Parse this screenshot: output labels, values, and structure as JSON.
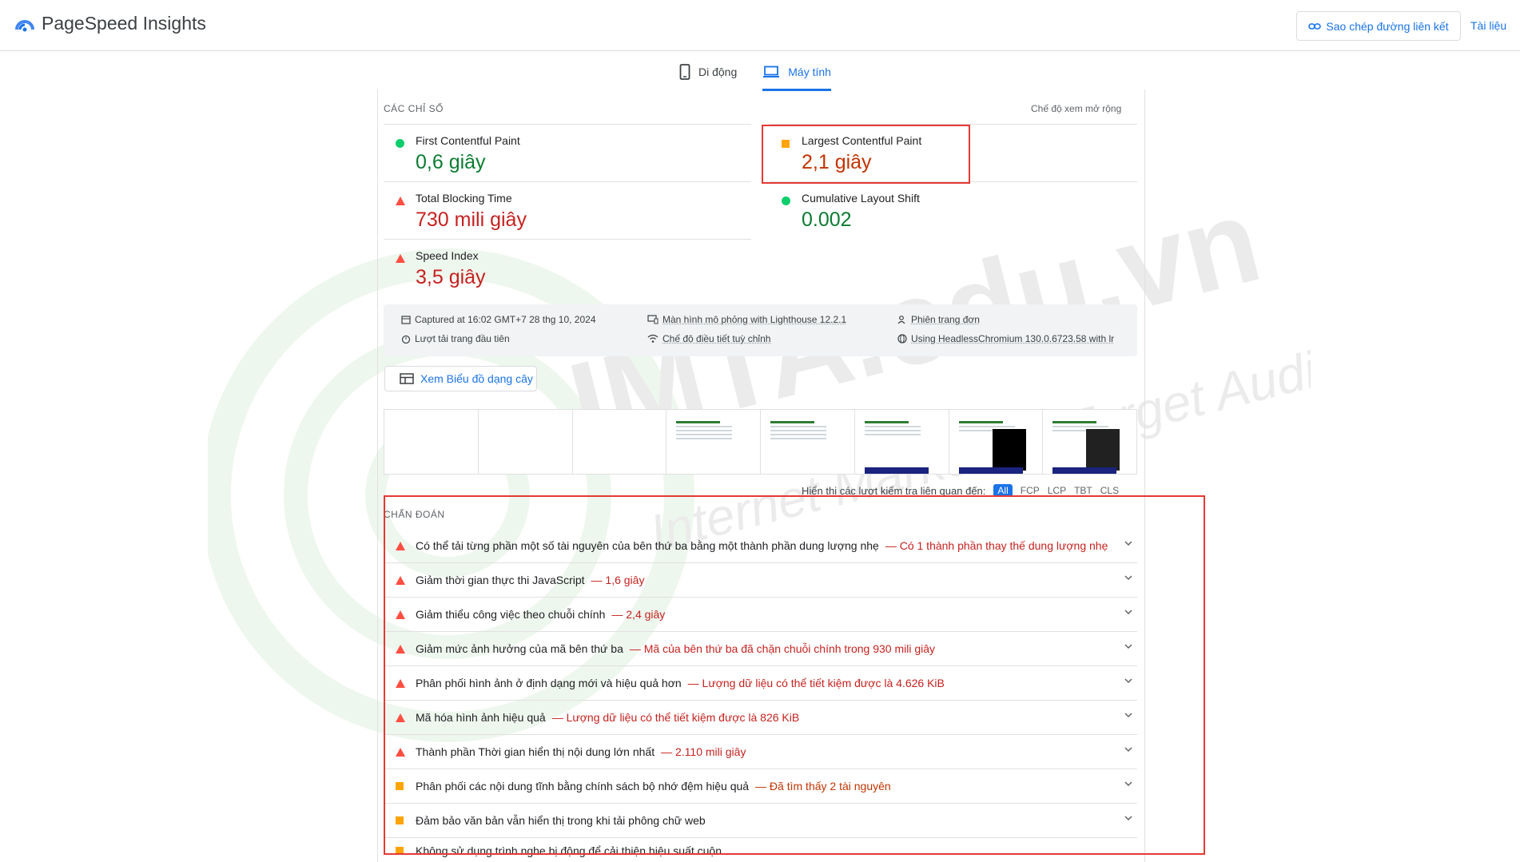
{
  "header": {
    "app_title": "PageSpeed Insights",
    "copy_link_label": "Sao chép đường liên kết",
    "docs_label": "Tài liệu"
  },
  "tabs": [
    {
      "label": "Di động",
      "active": false
    },
    {
      "label": "Máy tính",
      "active": true
    }
  ],
  "metrics_section": {
    "heading": "CÁC CHỈ SỐ",
    "expand_label": "Chế độ xem mở rộng",
    "metrics": [
      {
        "label": "First Contentful Paint",
        "value": "0,6 giây",
        "status": "good"
      },
      {
        "label": "Largest Contentful Paint",
        "value": "2,1 giây",
        "status": "average"
      },
      {
        "label": "Total Blocking Time",
        "value": "730 mili giây",
        "status": "poor"
      },
      {
        "label": "Cumulative Layout Shift",
        "value": "0.002",
        "status": "good"
      },
      {
        "label": "Speed Index",
        "value": "3,5 giây",
        "status": "poor"
      }
    ]
  },
  "runtime_info": {
    "captured": "Captured at 16:02 GMT+7 28 thg 10, 2024",
    "first_load": "Lượt tải trang đầu tiên",
    "emulation": "Màn hình mô phỏng with Lighthouse 12.2.1",
    "throttling": "Chế độ điều tiết tuỳ chỉnh",
    "session": "Phiên trang đơn",
    "browser": "Using HeadlessChromium 130.0.6723.58 with lr"
  },
  "treemap_button": "Xem Biểu đồ dạng cây",
  "filter": {
    "label": "Hiển thị các lượt kiểm tra liên quan đến:",
    "options": [
      "All",
      "FCP",
      "LCP",
      "TBT",
      "CLS"
    ],
    "selected": "All"
  },
  "diagnostics": {
    "heading": "CHẨN ĐOÁN",
    "items": [
      {
        "title": "Có thể tải từng phần một số tài nguyên của bên thứ ba bằng một thành phần dung lượng nhẹ",
        "display": "— Có 1 thành phần thay thế dung lượng nhẹ",
        "severity": "fail"
      },
      {
        "title": "Giảm thời gian thực thi JavaScript",
        "display": "— 1,6 giây",
        "severity": "fail"
      },
      {
        "title": "Giảm thiểu công việc theo chuỗi chính",
        "display": "— 2,4 giây",
        "severity": "fail"
      },
      {
        "title": "Giảm mức ảnh hưởng của mã bên thứ ba",
        "display": "— Mã của bên thứ ba đã chặn chuỗi chính trong 930 mili giây",
        "severity": "fail"
      },
      {
        "title": "Phân phối hình ảnh ở định dạng mới và hiệu quả hơn",
        "display": "— Lượng dữ liệu có thể tiết kiệm được là 4.626 KiB",
        "severity": "fail"
      },
      {
        "title": "Mã hóa hình ảnh hiệu quả",
        "display": "— Lượng dữ liệu có thể tiết kiệm được là 826 KiB",
        "severity": "fail"
      },
      {
        "title": "Thành phần Thời gian hiển thị nội dung lớn nhất",
        "display": "— 2.110 mili giây",
        "severity": "fail"
      },
      {
        "title": "Phân phối các nội dung tĩnh bằng chính sách bộ nhớ đệm hiệu quả",
        "display": "— Đã tìm thấy 2 tài nguyên",
        "severity": "average"
      },
      {
        "title": "Đảm bảo văn bản vẫn hiển thị trong khi tải phông chữ web",
        "display": "",
        "severity": "average"
      },
      {
        "title": "Không sử dụng trình nghe bị động để cải thiện hiệu suất cuộn",
        "display": "",
        "severity": "average"
      }
    ]
  },
  "watermark": {
    "brand": "IMTA.edu.vn",
    "tagline": "Internet Marketing Target Audience"
  },
  "colors": {
    "accent": "#1a73e8",
    "good": "#0c7c32",
    "average": "#c33300",
    "poor": "#c5221f",
    "highlight": "#e53935"
  }
}
